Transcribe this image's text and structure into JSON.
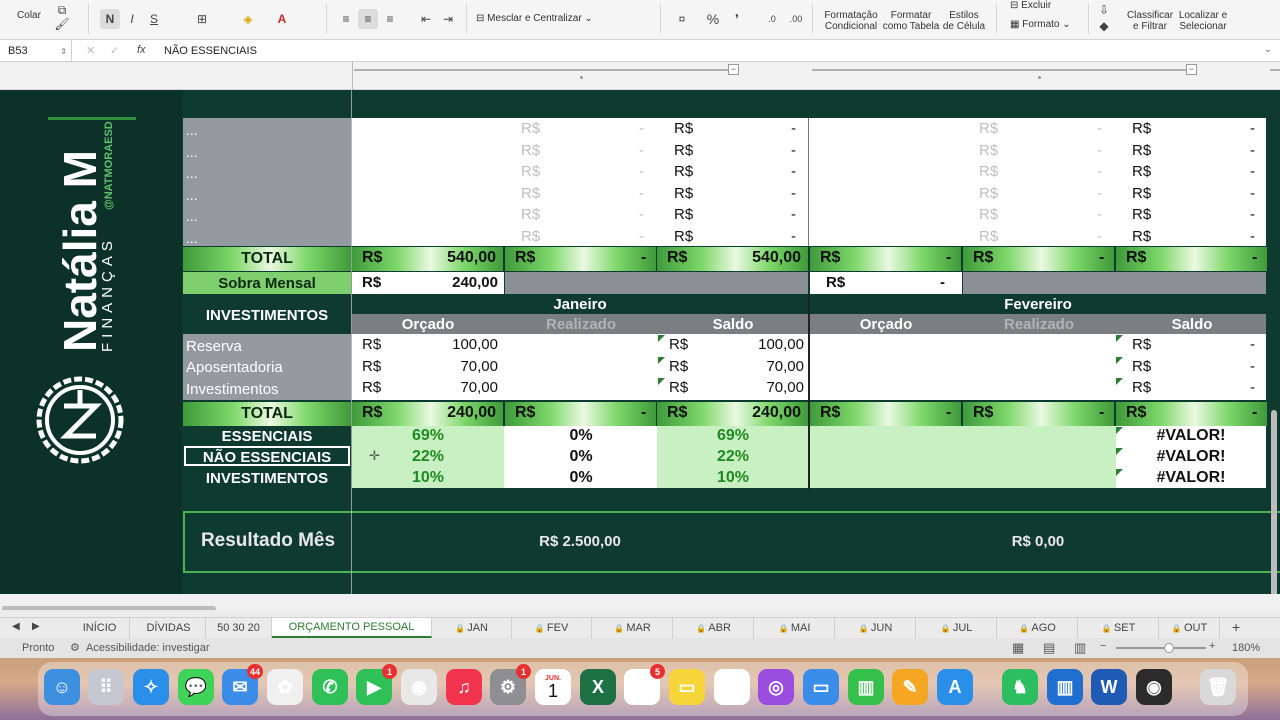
{
  "ribbon": {
    "paste_label": "Colar",
    "bold": "N",
    "italic": "I",
    "underline": "S",
    "merge_label": "Mesclar e Centralizar",
    "percent": "%",
    "cond_format": [
      "Formatação",
      "Condicional"
    ],
    "format_table": [
      "Formatar",
      "como Tabela"
    ],
    "cell_styles": [
      "Estilos",
      "de Célula"
    ],
    "delete_label": "Excluir",
    "format_label": "Formato",
    "sort_filter": [
      "Classificar",
      "e Filtrar"
    ],
    "find_select": [
      "Localizar e",
      "Selecionar"
    ]
  },
  "formula_bar": {
    "cell_ref": "B53",
    "fx": "fx",
    "content": "NÃO ESSENCIAIS"
  },
  "brand": {
    "name": "Natália M",
    "handle": "@NATMORAESD",
    "subtitle": "FINANÇAS"
  },
  "expense_rows": [
    "...",
    "...",
    "...",
    "...",
    "...",
    "..."
  ],
  "currency": "R$",
  "dash": "-",
  "total_label": "TOTAL",
  "total_row_1": {
    "jan_orcado": "540,00",
    "jan_saldo": "540,00"
  },
  "sobra": {
    "label": "Sobra Mensal",
    "value": "240,00"
  },
  "investimentos": {
    "section_label": "INVESTIMENTOS",
    "months": [
      "Janeiro",
      "Fevereiro"
    ],
    "cols": [
      "Orçado",
      "Realizado",
      "Saldo"
    ],
    "rows": [
      {
        "label": "Reserva",
        "orcado": "100,00",
        "saldo": "100,00"
      },
      {
        "label": "Aposentadoria",
        "orcado": "70,00",
        "saldo": "70,00"
      },
      {
        "label": "Investimentos",
        "orcado": "70,00",
        "saldo": "70,00"
      }
    ]
  },
  "total_row_2": {
    "jan_orcado": "240,00",
    "jan_saldo": "240,00"
  },
  "summary": [
    {
      "label": "ESSENCIAIS",
      "orcado": "69%",
      "realizado": "0%",
      "saldo": "69%",
      "fev": "#VALOR!"
    },
    {
      "label": "NÃO ESSENCIAIS",
      "orcado": "22%",
      "realizado": "0%",
      "saldo": "22%",
      "fev": "#VALOR!"
    },
    {
      "label": "INVESTIMENTOS",
      "orcado": "10%",
      "realizado": "0%",
      "saldo": "10%",
      "fev": "#VALOR!"
    }
  ],
  "resultado": {
    "label": "Resultado Mês",
    "jan": "R$ 2.500,00",
    "fev": "R$ 0,00"
  },
  "tabs": [
    "INÍCIO",
    "DÍVIDAS",
    "50 30 20",
    "ORÇAMENTO PESSOAL",
    "JAN",
    "FEV",
    "MAR",
    "ABR",
    "MAI",
    "JUN",
    "JUL",
    "AGO",
    "SET",
    "OUT"
  ],
  "active_tab": "ORÇAMENTO PESSOAL",
  "status": {
    "ready": "Pronto",
    "accessibility": "Acessibilidade: investigar",
    "zoom": "180%"
  },
  "dock": {
    "calendar_month": "JUN.",
    "calendar_day": "1",
    "badges": {
      "mail": "44",
      "facetime": "1",
      "settings": "1",
      "reminders": "5"
    }
  }
}
